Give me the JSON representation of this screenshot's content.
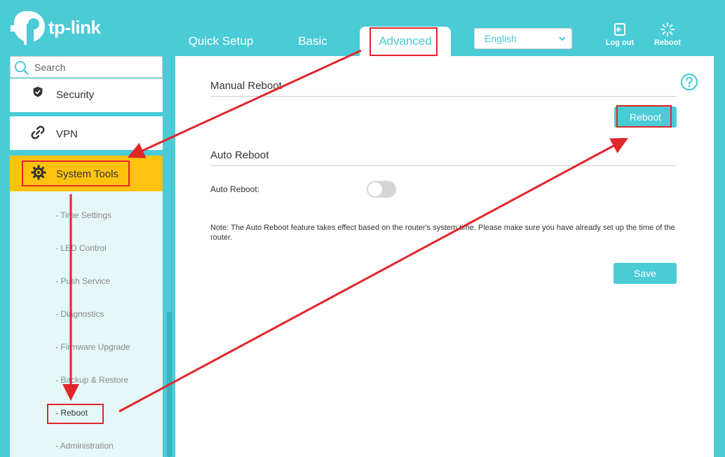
{
  "header": {
    "brand": "tp-link",
    "tabs": [
      {
        "label": "Quick Setup"
      },
      {
        "label": "Basic"
      },
      {
        "label": "Advanced"
      }
    ],
    "language": "English",
    "logout_label": "Log out",
    "reboot_label": "Reboot",
    "colors": {
      "accent": "#4acbd6",
      "highlight": "#ffc20e",
      "annotation": "#e0262b"
    }
  },
  "sidebar": {
    "search_placeholder": "Search",
    "items": [
      {
        "label": "Security",
        "icon": "shield-icon"
      },
      {
        "label": "VPN",
        "icon": "link-icon"
      },
      {
        "label": "System Tools",
        "icon": "gear-icon"
      }
    ],
    "submenu": [
      {
        "label": "- Time Settings"
      },
      {
        "label": "- LED Control"
      },
      {
        "label": "- Push Service"
      },
      {
        "label": "- Diagnostics"
      },
      {
        "label": "- Firmware Upgrade"
      },
      {
        "label": "- Backup & Restore"
      },
      {
        "label": "- Reboot"
      },
      {
        "label": "- Administration"
      }
    ]
  },
  "main": {
    "manual_title": "Manual Reboot",
    "reboot_button": "Reboot",
    "auto_title": "Auto Reboot",
    "auto_label": "Auto Reboot:",
    "auto_enabled": false,
    "note": "Note: The Auto Reboot feature takes effect based on the router's system time. Please make sure you have already set up the time of the router.",
    "save_button": "Save"
  }
}
